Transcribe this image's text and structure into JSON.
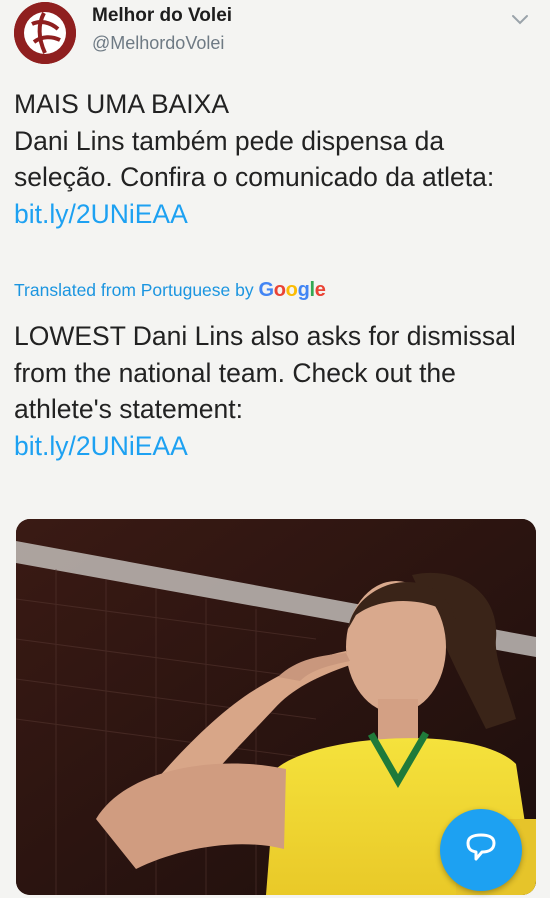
{
  "account": {
    "display_name": "Melhor do Volei",
    "handle": "@MelhordoVolei"
  },
  "tweet": {
    "headline": "MAIS UMA BAIXA",
    "body": "Dani Lins também pede dispensa da seleção. Confira o comunicado da atleta: ",
    "link": "bit.ly/2UNiEAA"
  },
  "translation": {
    "label": "Translated from Portuguese by",
    "provider": "Google",
    "text": "LOWEST Dani Lins also asks for dismissal from the national team. Check out the athlete's statement: ",
    "link": "bit.ly/2UNiEAA"
  },
  "icons": {
    "menu": "chevron-down-icon",
    "compose": "compose-icon"
  },
  "colors": {
    "link": "#1da1f2",
    "fab": "#1da1f2",
    "avatar": "#8f1f1f"
  }
}
